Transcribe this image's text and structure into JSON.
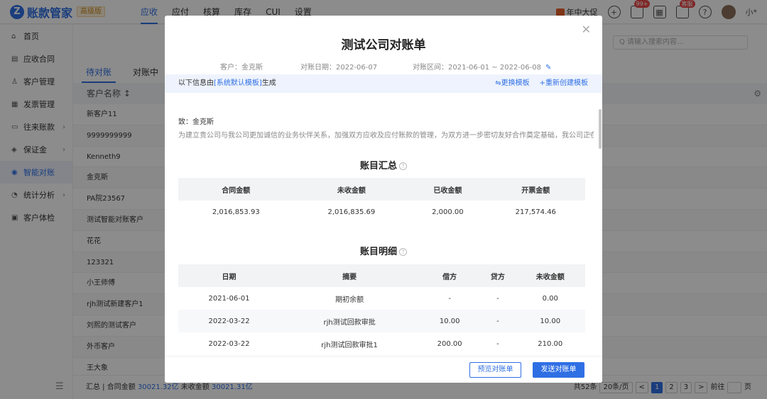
{
  "app": {
    "logo_mark": "Z",
    "logo_text": "账款管家",
    "badge": "高级版"
  },
  "top_nav": [
    "应收",
    "应付",
    "核算",
    "库存",
    "CUI",
    "设置"
  ],
  "top_right": {
    "promo": "年中大促",
    "notify_badge": "99+",
    "service_badge": "客服",
    "user": "小*"
  },
  "sidebar": [
    {
      "icon": "⌂",
      "label": "首页",
      "arrow": ""
    },
    {
      "icon": "▤",
      "label": "应收合同",
      "arrow": ""
    },
    {
      "icon": "♙",
      "label": "客户管理",
      "arrow": ""
    },
    {
      "icon": "▦",
      "label": "发票管理",
      "arrow": ""
    },
    {
      "icon": "▭",
      "label": "往来账款",
      "arrow": "›"
    },
    {
      "icon": "◈",
      "label": "保证金",
      "arrow": "›"
    },
    {
      "icon": "◉",
      "label": "智能对账",
      "arrow": ""
    },
    {
      "icon": "◔",
      "label": "统计分析",
      "arrow": "›"
    },
    {
      "icon": "▣",
      "label": "客户体检",
      "arrow": ""
    }
  ],
  "main": {
    "search_placeholder": "Q 请输入搜索内容...",
    "tabs": [
      "待对账",
      "对账中"
    ],
    "list_header": "客户名称 ↕",
    "rows": [
      "新客户11",
      "9999999999",
      "Kenneth9",
      "金克斯",
      "PA院23567",
      "测试智能对账客户",
      "花花",
      "123321",
      "小王师傅",
      "rjh测试新建客户1",
      "刘熙的测试客户",
      "外币客户",
      "王大象"
    ],
    "footer_prefix": "汇总 | 合同金额 ",
    "footer_amount1": "30021.32亿",
    "footer_mid": "  未收金额 ",
    "footer_amount2": "30021.31亿",
    "pager_total": "共52条",
    "pager_size": "20条/页",
    "pager_prev": "<",
    "pager_pages": [
      "1",
      "2",
      "3"
    ],
    "pager_next": ">",
    "pager_goto": "前往",
    "pager_page_unit": "页"
  },
  "modal": {
    "title": "测试公司对账单",
    "customer": "客户：金克斯",
    "date": "对账日期：2022-06-07",
    "range": "对账区间：2021-06-01 ~ 2022-06-08",
    "tip_prefix": "以下信息由",
    "tip_link": "[系统默认模板]",
    "tip_suffix": "生成",
    "tip_action1": "⇋更换模板",
    "tip_action2": "+重新创建模板",
    "to": "致：金克斯",
    "intro": "为建立贵公司与我公司更加诚信的业务伙伴关系，加强双方应收及应付账款的管理，为双方进一步密切友好合作奠定基础，我公司正在对贵公...",
    "summary_title": "账目汇总",
    "summary_headers": [
      "合同金额",
      "未收金额",
      "已收金额",
      "开票金额"
    ],
    "summary_values": [
      "2,016,853.93",
      "2,016,835.69",
      "2,000.00",
      "217,574.46"
    ],
    "detail_title": "账目明细",
    "detail_headers": [
      "日期",
      "摘要",
      "借方",
      "贷方",
      "未收金额"
    ],
    "detail_rows": [
      [
        "2021-06-01",
        "期初余额",
        "-",
        "-",
        "0.00"
      ],
      [
        "2022-03-22",
        "rjh测试回款审批",
        "10.00",
        "-",
        "10.00"
      ],
      [
        "2022-03-22",
        "rjh测试回款审批1",
        "200.00",
        "-",
        "210.00"
      ]
    ],
    "btn_preview": "预览对账单",
    "btn_send": "发送对账单"
  }
}
